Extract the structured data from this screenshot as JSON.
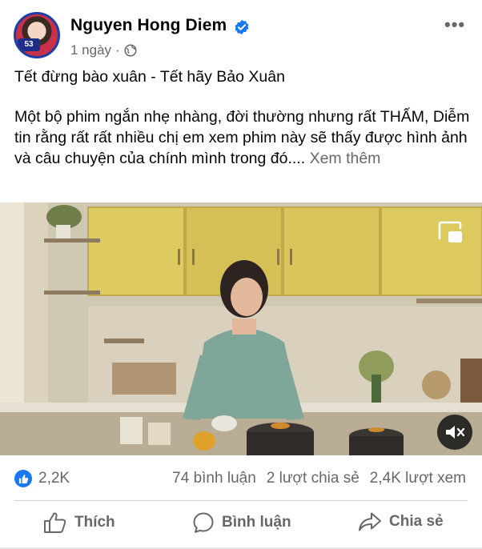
{
  "post": {
    "author_name": "Nguyen Hong Diem",
    "avatar_badge": "53",
    "time": "1 ngày",
    "separator": "·",
    "title_line": "Tết đừng bào xuân - Tết hãy Bảo Xuân",
    "body": "Một bộ phim ngắn nhẹ nhàng, đời thường nhưng rất THẤM, Diễm tin rằng rất rất nhiều chị em xem phim này sẽ thấy được hình ảnh và câu chuyện của chính mình trong đó....",
    "see_more": "Xem thêm"
  },
  "stats": {
    "likes": "2,2K",
    "comments": "74 bình luận",
    "shares": "2 lượt chia sẻ",
    "views": "2,4K lượt xem"
  },
  "actions": {
    "like": "Thích",
    "comment": "Bình luận",
    "share": "Chia sẻ"
  },
  "colors": {
    "accent": "#1877f2",
    "secondary_text": "#65676b",
    "verified_badge": "#1877f2"
  },
  "icons": [
    "verified-icon",
    "globe-icon",
    "more-options-icon",
    "picture-in-picture-icon",
    "mute-icon",
    "like-reaction-icon",
    "thumbs-up-icon",
    "comment-bubble-icon",
    "share-arrow-icon"
  ]
}
